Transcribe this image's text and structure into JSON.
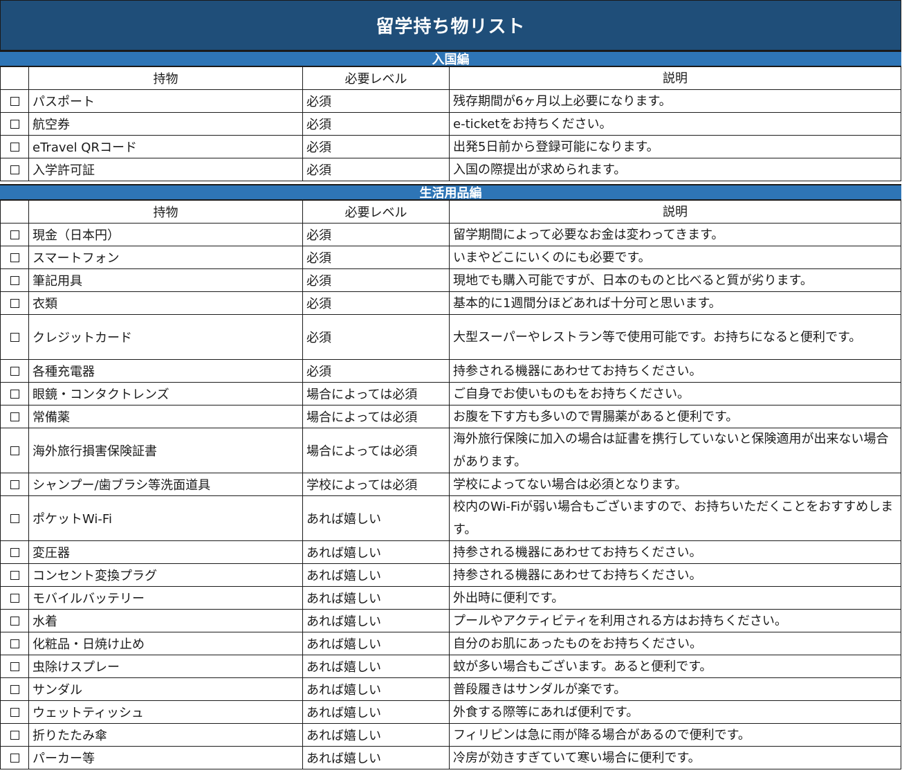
{
  "title": "留学持ち物リスト",
  "colors": {
    "title_bg": "#1f4e79",
    "section_bg": "#2e75b6",
    "text": "#1a1a1a",
    "white": "#ffffff"
  },
  "headers": {
    "item": "持物",
    "level": "必要レベル",
    "description": "説明"
  },
  "sections": [
    {
      "name": "入国編",
      "rows": [
        {
          "item": "パスポート",
          "level": "必須",
          "description": "残存期間が6ヶ月以上必要になります。"
        },
        {
          "item": "航空券",
          "level": "必須",
          "description": "e-ticketをお持ちください。"
        },
        {
          "item": "eTravel QRコード",
          "level": "必須",
          "description": "出発5日前から登録可能になります。"
        },
        {
          "item": "入学許可証",
          "level": "必須",
          "description": "入国の際提出が求められます。"
        }
      ]
    },
    {
      "name": "生活用品編",
      "rows": [
        {
          "item": "現金（日本円）",
          "level": "必須",
          "description": "留学期間によって必要なお金は変わってきます。"
        },
        {
          "item": "スマートフォン",
          "level": "必須",
          "description": "いまやどこにいくのにも必要です。"
        },
        {
          "item": "筆記用具",
          "level": "必須",
          "description": "現地でも購入可能ですが、日本のものと比べると質が劣ります。"
        },
        {
          "item": "衣類",
          "level": "必須",
          "description": "基本的に1週間分ほどあれば十分可と思います。"
        },
        {
          "item": "クレジットカード",
          "level": "必須",
          "description": "大型スーパーやレストラン等で使用可能です。お持ちになると便利です。"
        },
        {
          "item": "各種充電器",
          "level": "必須",
          "description": "持参される機器にあわせてお持ちください。"
        },
        {
          "item": "眼鏡・コンタクトレンズ",
          "level": "場合によっては必須",
          "description": "ご自身でお使いものもをお持ちください。"
        },
        {
          "item": "常備薬",
          "level": "場合によっては必須",
          "description": "お腹を下す方も多いので胃腸薬があると便利です。"
        },
        {
          "item": "海外旅行損害保険証書",
          "level": "場合によっては必須",
          "description": "海外旅行保険に加入の場合は証書を携行していないと保険適用が出来ない場合があります。"
        },
        {
          "item": "シャンプー/歯ブラシ等洗面道具",
          "level": "学校によっては必須",
          "description": "学校によってない場合は必須となります。"
        },
        {
          "item": "ポケットWi-Fi",
          "level": "あれば嬉しい",
          "description": "校内のWi-Fiが弱い場合もございますので、お持ちいただくことをおすすめします。"
        },
        {
          "item": "変圧器",
          "level": "あれば嬉しい",
          "description": "持参される機器にあわせてお持ちください。"
        },
        {
          "item": "コンセント変換プラグ",
          "level": "あれば嬉しい",
          "description": "持参される機器にあわせてお持ちください。"
        },
        {
          "item": "モバイルバッテリー",
          "level": "あれば嬉しい",
          "description": "外出時に便利です。"
        },
        {
          "item": "水着",
          "level": "あれば嬉しい",
          "description": "プールやアクティビティを利用される方はお持ちください。"
        },
        {
          "item": "化粧品・日焼け止め",
          "level": "あれば嬉しい",
          "description": "自分のお肌にあったものをお持ちください。"
        },
        {
          "item": "虫除けスプレー",
          "level": "あれば嬉しい",
          "description": "蚊が多い場合もございます。あると便利です。"
        },
        {
          "item": "サンダル",
          "level": "あれば嬉しい",
          "description": "普段履きはサンダルが楽です。"
        },
        {
          "item": "ウェットティッシュ",
          "level": "あれば嬉しい",
          "description": "外食する際等にあれば便利です。"
        },
        {
          "item": "折りたたみ傘",
          "level": "あれば嬉しい",
          "description": "フィリピンは急に雨が降る場合があるので便利です。"
        },
        {
          "item": "パーカー等",
          "level": "あれば嬉しい",
          "description": "冷房が効きすぎていて寒い場合に便利です。"
        }
      ]
    }
  ]
}
